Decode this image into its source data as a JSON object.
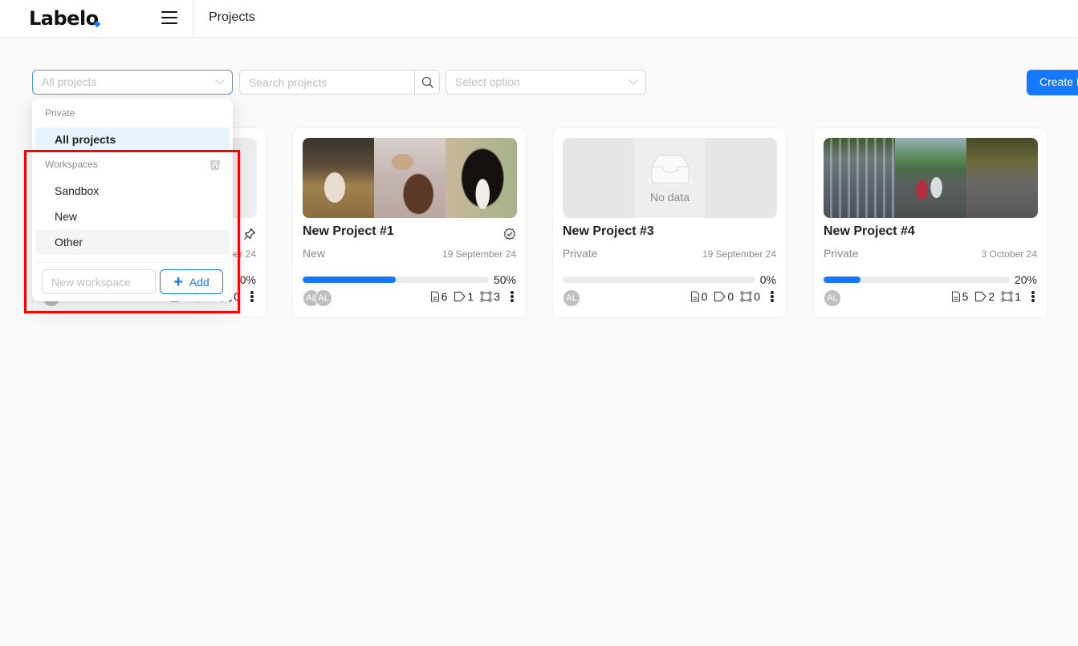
{
  "header": {
    "logo": "Labelo",
    "title": "Projects"
  },
  "toolbar": {
    "project_filter_value": "All projects",
    "search_placeholder": "Search projects",
    "option_placeholder": "Select option",
    "create_label": "Create Project"
  },
  "dropdown": {
    "private_label": "Private",
    "private_items": [
      {
        "label": "All projects",
        "selected": true
      }
    ],
    "workspaces_label": "Workspaces",
    "workspace_items": [
      {
        "label": "Sandbox"
      },
      {
        "label": "New"
      },
      {
        "label": "Other",
        "hovered": true
      }
    ],
    "new_workspace_placeholder": "New workspace",
    "add_label": "Add"
  },
  "cards": [
    {
      "title": "",
      "workspace": "",
      "date": "…ber 24",
      "progress_percent": 0,
      "progress_label": "0%",
      "pinned": true,
      "avatars": [
        "AL"
      ],
      "tasks": "0",
      "labels": "0",
      "annotations": "0"
    },
    {
      "title": "New Project #1",
      "workspace": "New",
      "date": "19 September 24",
      "progress_percent": 50,
      "progress_label": "50%",
      "verified": true,
      "avatars": [
        "AL",
        "AL"
      ],
      "tasks": "6",
      "labels": "1",
      "annotations": "3",
      "thumbnails": [
        "dog-poodle",
        "dog-shepherd",
        "dog-bernese"
      ]
    },
    {
      "title": "New Project #3",
      "workspace": "Private",
      "date": "19 September 24",
      "progress_percent": 0,
      "progress_label": "0%",
      "avatars": [
        "AL"
      ],
      "tasks": "0",
      "labels": "0",
      "annotations": "0",
      "no_data_label": "No data"
    },
    {
      "title": "New Project #4",
      "workspace": "Private",
      "date": "3 October 24",
      "progress_percent": 20,
      "progress_label": "20%",
      "avatars": [
        "AL"
      ],
      "tasks": "5",
      "labels": "2",
      "annotations": "1",
      "thumbnails": [
        "traffic-highway",
        "traffic-trucks",
        "traffic-street"
      ]
    }
  ],
  "colors": {
    "accent": "#1677ff",
    "highlight": "#ff0000"
  }
}
